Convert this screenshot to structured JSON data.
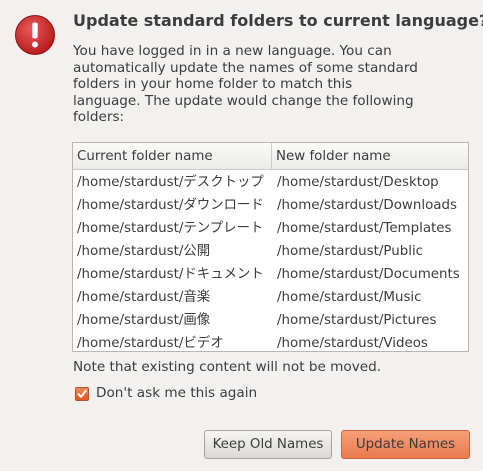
{
  "dialog": {
    "title": "Update standard folders to current language?",
    "message": "You have logged in in a new language. You can\nautomatically update the names of some standard\nfolders in your home folder to match this\nlanguage. The update would change the following\nfolders:",
    "note": "Note that existing content will not be moved.",
    "checkbox_label": "Don't ask me this again",
    "checkbox_checked": true,
    "warning_icon": "warning-icon",
    "accent_color": "#e8764a",
    "icon_color": "#cc2a2a"
  },
  "table": {
    "headers": [
      "Current folder name",
      "New folder name"
    ],
    "rows": [
      [
        "/home/stardust/デスクトップ",
        "/home/stardust/Desktop"
      ],
      [
        "/home/stardust/ダウンロード",
        "/home/stardust/Downloads"
      ],
      [
        "/home/stardust/テンプレート",
        "/home/stardust/Templates"
      ],
      [
        "/home/stardust/公開",
        "/home/stardust/Public"
      ],
      [
        "/home/stardust/ドキュメント",
        "/home/stardust/Documents"
      ],
      [
        "/home/stardust/音楽",
        "/home/stardust/Music"
      ],
      [
        "/home/stardust/画像",
        "/home/stardust/Pictures"
      ],
      [
        "/home/stardust/ビデオ",
        "/home/stardust/Videos"
      ]
    ]
  },
  "buttons": {
    "keep_label": "Keep Old Names",
    "update_label": "Update Names"
  }
}
